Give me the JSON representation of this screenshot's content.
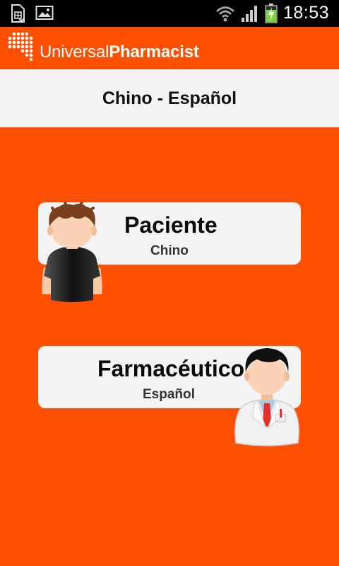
{
  "status_bar": {
    "time": "18:53",
    "icons": [
      "sim-card-icon",
      "image-icon",
      "wifi-icon",
      "signal-icon",
      "battery-charging-icon"
    ]
  },
  "app": {
    "brand_light": "Universal",
    "brand_bold": "Pharmacist",
    "logo_icon": "dot-matrix-logo"
  },
  "language_pair": {
    "label": "Chino - Español"
  },
  "roles": [
    {
      "title": "Paciente",
      "language": "Chino",
      "avatar_icon": "patient-avatar-icon"
    },
    {
      "title": "Farmacéutico",
      "language": "Español",
      "avatar_icon": "pharmacist-avatar-icon"
    }
  ],
  "colors": {
    "accent": "#ff5000",
    "card": "#f4f4f4",
    "header_band": "#f3f3f3",
    "status_bar": "#000000"
  }
}
